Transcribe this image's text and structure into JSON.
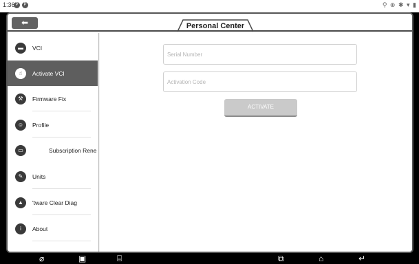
{
  "status_bar": {
    "time": "1:36",
    "left_icons": [
      "P",
      "P"
    ],
    "right_icons": "⚲ ⊕ ✱ ▾ ▮"
  },
  "header": {
    "back_icon": "back-arrow-icon",
    "title": "Personal Center"
  },
  "sidebar": {
    "items": [
      {
        "label": "VCI",
        "icon": "vci-icon",
        "active": false
      },
      {
        "label": "Activate VCI",
        "icon": "activate-icon",
        "active": true
      },
      {
        "label": "Firmware Fix",
        "icon": "wrench-icon",
        "active": false
      },
      {
        "label": "Profile",
        "icon": "user-icon",
        "active": false
      },
      {
        "label": "Subscription Rene",
        "icon": "subscription-icon",
        "active": false
      },
      {
        "label": "Units",
        "icon": "pencil-icon",
        "active": false
      },
      {
        "label": "'tware Clear       Diag",
        "icon": "bell-icon",
        "active": false
      },
      {
        "label": "About",
        "icon": "info-icon",
        "active": false
      }
    ]
  },
  "form": {
    "serial_placeholder": "Serial Number",
    "activation_placeholder": "Activation Code",
    "activate_label": "ACTIVATE"
  },
  "nav_bar": {
    "icons": [
      "browser-icon",
      "gallery-icon",
      "vci-connector-icon",
      "recents-icon",
      "home-icon",
      "back-icon"
    ]
  }
}
